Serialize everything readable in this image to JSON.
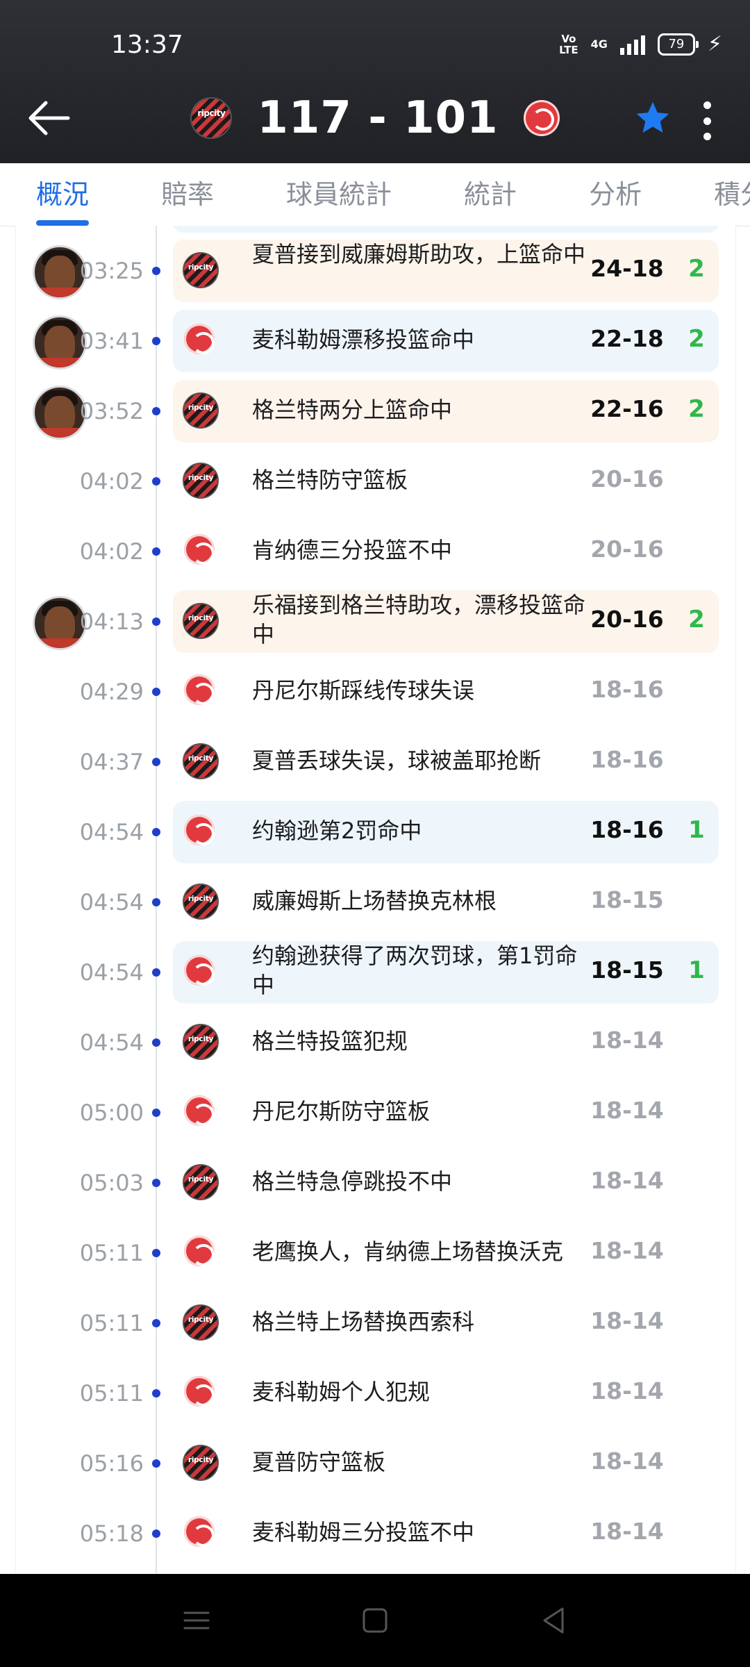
{
  "status": {
    "time": "13:37",
    "network_top": "Vo",
    "network_bottom": "LTE",
    "signal": "4G",
    "battery": "79"
  },
  "header": {
    "score": "117 - 101",
    "home_logo_text": "ripcity"
  },
  "tabs": [
    "概況",
    "賠率",
    "球員統計",
    "統計",
    "分析",
    "積分"
  ],
  "colors": {
    "accent": "#1f6fe5",
    "points": "#2fb84a",
    "timeline_dot": "#1f3fc9",
    "por_card": "#fdf4ec",
    "atl_card": "#eef6fb"
  },
  "plays": [
    {
      "time": "03:25",
      "team": "por",
      "text": "夏普接到威廉姆斯助攻，上篮命中",
      "score": "24-18",
      "points": "2",
      "avatar": true
    },
    {
      "time": "03:41",
      "team": "atl",
      "text": "麦科勒姆漂移投篮命中",
      "score": "22-18",
      "points": "2",
      "avatar": true
    },
    {
      "time": "03:52",
      "team": "por",
      "text": "格兰特两分上篮命中",
      "score": "22-16",
      "points": "2",
      "avatar": true
    },
    {
      "time": "04:02",
      "team": "por",
      "text": "格兰特防守篮板",
      "score": "20-16",
      "points": "",
      "avatar": false
    },
    {
      "time": "04:02",
      "team": "atl",
      "text": "肯纳德三分投篮不中",
      "score": "20-16",
      "points": "",
      "avatar": false
    },
    {
      "time": "04:13",
      "team": "por",
      "text": "乐福接到格兰特助攻，漂移投篮命中",
      "score": "20-16",
      "points": "2",
      "avatar": true
    },
    {
      "time": "04:29",
      "team": "atl",
      "text": "丹尼尔斯踩线传球失误",
      "score": "18-16",
      "points": "",
      "avatar": false
    },
    {
      "time": "04:37",
      "team": "por",
      "text": "夏普丢球失误，球被盖耶抢断",
      "score": "18-16",
      "points": "",
      "avatar": false
    },
    {
      "time": "04:54",
      "team": "atl",
      "text": "约翰逊第2罚命中",
      "score": "18-16",
      "points": "1",
      "avatar": false
    },
    {
      "time": "04:54",
      "team": "por",
      "text": "威廉姆斯上场替换克林根",
      "score": "18-15",
      "points": "",
      "avatar": false
    },
    {
      "time": "04:54",
      "team": "atl",
      "text": "约翰逊获得了两次罚球，第1罚命中",
      "score": "18-15",
      "points": "1",
      "avatar": false
    },
    {
      "time": "04:54",
      "team": "por",
      "text": "格兰特投篮犯规",
      "score": "18-14",
      "points": "",
      "avatar": false
    },
    {
      "time": "05:00",
      "team": "atl",
      "text": "丹尼尔斯防守篮板",
      "score": "18-14",
      "points": "",
      "avatar": false
    },
    {
      "time": "05:03",
      "team": "por",
      "text": "格兰特急停跳投不中",
      "score": "18-14",
      "points": "",
      "avatar": false
    },
    {
      "time": "05:11",
      "team": "atl",
      "text": "老鹰换人，肯纳德上场替换沃克",
      "score": "18-14",
      "points": "",
      "avatar": false
    },
    {
      "time": "05:11",
      "team": "por",
      "text": "格兰特上场替换西索科",
      "score": "18-14",
      "points": "",
      "avatar": false
    },
    {
      "time": "05:11",
      "team": "atl",
      "text": "麦科勒姆个人犯规",
      "score": "18-14",
      "points": "",
      "avatar": false
    },
    {
      "time": "05:16",
      "team": "por",
      "text": "夏普防守篮板",
      "score": "18-14",
      "points": "",
      "avatar": false
    },
    {
      "time": "05:18",
      "team": "atl",
      "text": "麦科勒姆三分投篮不中",
      "score": "18-14",
      "points": "",
      "avatar": false
    }
  ]
}
